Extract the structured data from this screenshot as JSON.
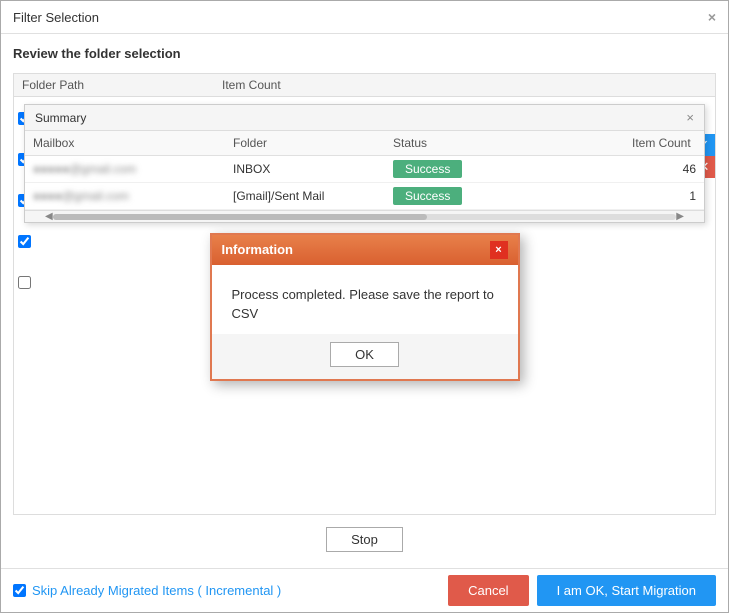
{
  "window": {
    "title": "Filter Selection",
    "close_label": "×"
  },
  "header": {
    "section_title": "Review the folder selection"
  },
  "folder_table": {
    "col_folder_path": "Folder Path",
    "col_item_count": "Item Count"
  },
  "summary": {
    "title": "Summary",
    "close_label": "×",
    "columns": {
      "mailbox": "Mailbox",
      "folder": "Folder",
      "status": "Status",
      "item_count": "Item Count"
    },
    "rows": [
      {
        "mailbox_blurred": "●●●●●@gmail.com",
        "folder": "INBOX",
        "status": "Success",
        "item_count": "46"
      },
      {
        "mailbox_blurred": "●●●●@gmail.com",
        "folder": "[Gmail]/Sent Mail",
        "status": "Success",
        "item_count": "1"
      }
    ]
  },
  "information_dialog": {
    "title": "Information",
    "close_label": "×",
    "message": "Process completed. Please save the report to CSV",
    "ok_label": "OK"
  },
  "stop_button": {
    "label": "Stop"
  },
  "bottom": {
    "skip_label": "Skip Already Migrated Items ( Incremental )",
    "cancel_label": "Cancel",
    "start_label": "I am OK, Start Migration"
  },
  "blue_tabs": {
    "check_icon": "✓",
    "close_icon": "✕"
  }
}
